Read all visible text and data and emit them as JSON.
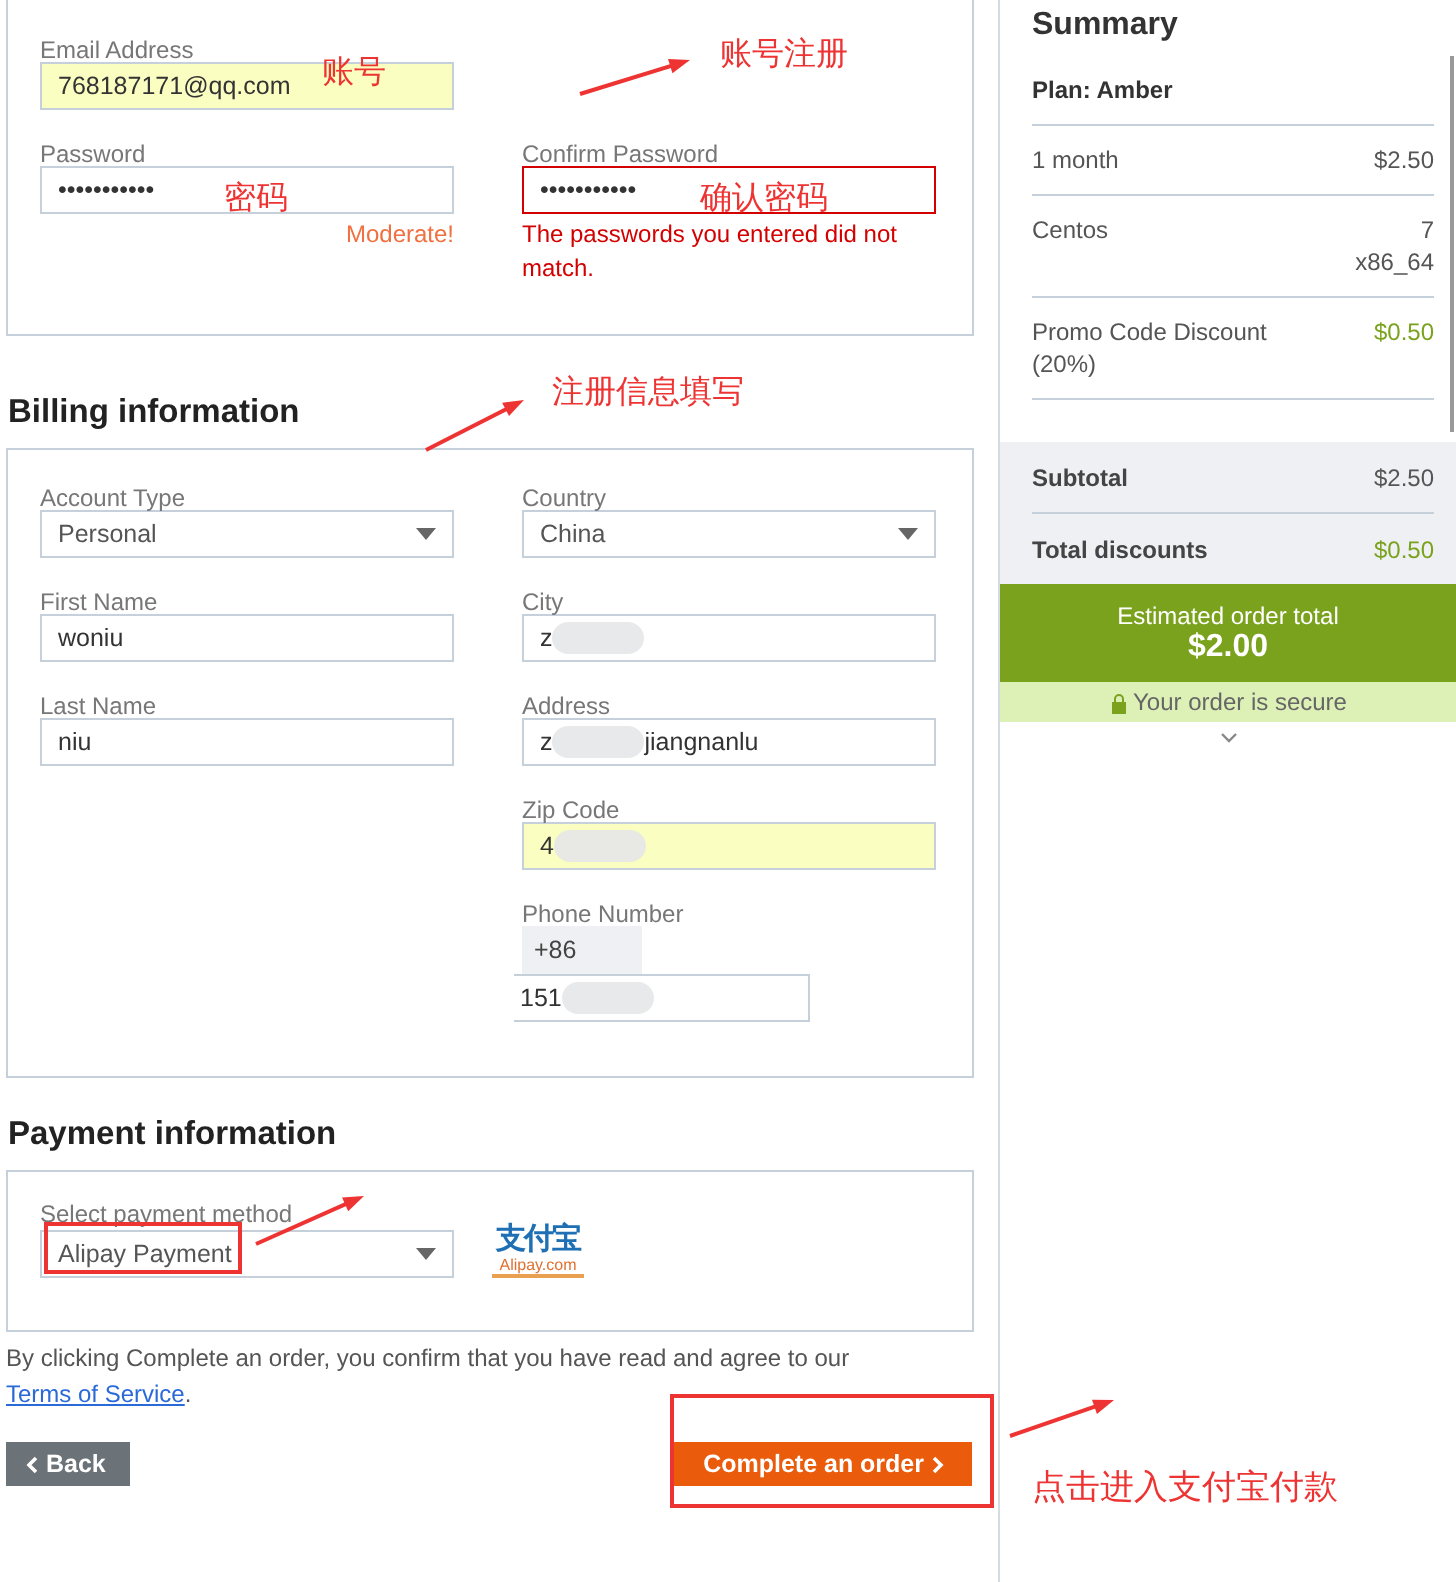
{
  "account": {
    "fields": [
      {
        "label": "Email Address",
        "kind": "text",
        "autofilled": true,
        "invalid": false,
        "parts": [
          {
            "kind": "text",
            "text": "768187171@qq.com"
          }
        ]
      },
      {
        "label": "Password",
        "kind": "text",
        "autofilled": false,
        "invalid": false,
        "parts": [
          {
            "kind": "text",
            "text": "•••••••••••"
          }
        ],
        "hint": "Moderate!"
      },
      {
        "label": "Confirm Password",
        "kind": "text",
        "autofilled": false,
        "invalid": true,
        "parts": [
          {
            "kind": "text",
            "text": "•••••••••••"
          }
        ],
        "error": "The passwords you entered did not match."
      }
    ]
  },
  "billing": {
    "title": "Billing information",
    "left": [
      {
        "label": "Account Type",
        "kind": "select",
        "parts": [
          {
            "kind": "text",
            "text": "Personal"
          }
        ]
      },
      {
        "label": "First Name",
        "kind": "text",
        "autofilled": false,
        "parts": [
          {
            "kind": "text",
            "text": "woniu"
          }
        ]
      },
      {
        "label": "Last Name",
        "kind": "text",
        "autofilled": false,
        "parts": [
          {
            "kind": "text",
            "text": "niu"
          }
        ]
      }
    ],
    "right": [
      {
        "label": "Country",
        "kind": "select",
        "parts": [
          {
            "kind": "text",
            "text": "China"
          }
        ]
      },
      {
        "label": "City",
        "kind": "text",
        "autofilled": false,
        "parts": [
          {
            "kind": "text",
            "text": "z"
          },
          {
            "kind": "blur"
          }
        ]
      },
      {
        "label": "Address",
        "kind": "text",
        "autofilled": false,
        "parts": [
          {
            "kind": "text",
            "text": "z"
          },
          {
            "kind": "blur"
          },
          {
            "kind": "text",
            "text": "jiangnanlu"
          }
        ]
      },
      {
        "label": "Zip Code",
        "kind": "text",
        "autofilled": true,
        "parts": [
          {
            "kind": "text",
            "text": "4"
          },
          {
            "kind": "blur"
          }
        ]
      },
      {
        "label": "Phone Number",
        "kind": "phone",
        "prefix": "+86",
        "parts": [
          {
            "kind": "text",
            "text": "151"
          },
          {
            "kind": "blur"
          }
        ]
      }
    ]
  },
  "payment": {
    "title": "Payment information",
    "label": "Select payment method",
    "value": "Alipay Payment",
    "logo": {
      "text": "支付宝",
      "caption": "Alipay.com"
    }
  },
  "terms": {
    "text": "By clicking Complete an order, you confirm that you have read and agree to our ",
    "link": "Terms of Service",
    "end": "."
  },
  "buttons": {
    "back": "Back",
    "complete": "Complete an order"
  },
  "summary": {
    "title": "Summary",
    "plan": "Plan: Amber",
    "lines": [
      {
        "label": "1 month",
        "amount": "$2.50",
        "kind": "plain"
      },
      {
        "label": "Centos",
        "amount": "7 x86_64",
        "kind": "plain"
      },
      {
        "label": "Promo Code Discount (20%)",
        "amount": "$0.50",
        "kind": "discount"
      }
    ],
    "totals": [
      {
        "label": "Subtotal",
        "amount": "$2.50",
        "kind": "plain"
      },
      {
        "label": "Total discounts",
        "amount": "$0.50",
        "kind": "discount"
      }
    ],
    "estimate": {
      "label": "Estimated order total",
      "amount": "$2.00"
    },
    "secure": "Your order is secure"
  },
  "annotations": [
    "账号",
    "账号注册",
    "密码",
    "确认密码",
    "注册信息填写",
    "点击进入支付宝付款"
  ]
}
